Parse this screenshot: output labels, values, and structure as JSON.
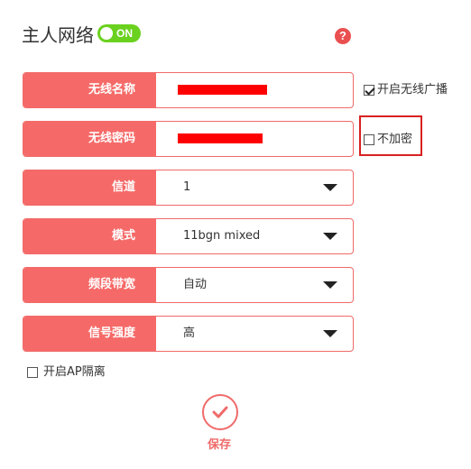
{
  "header": {
    "title": "主人网络",
    "toggle_label": "ON",
    "help_symbol": "?"
  },
  "fields": [
    {
      "label": "无线名称",
      "value": "",
      "redacted": true
    },
    {
      "label": "无线密码",
      "value": "",
      "redacted": true
    },
    {
      "label": "信道",
      "value": "1"
    },
    {
      "label": "模式",
      "value": "11bgn mixed"
    },
    {
      "label": "频段带宽",
      "value": "自动"
    },
    {
      "label": "信号强度",
      "value": "高"
    }
  ],
  "options": {
    "broadcast_label": "开启无线广播",
    "broadcast_checked": true,
    "no_encrypt_label": "不加密",
    "no_encrypt_checked": false,
    "ap_isolation_label": "开启AP隔离",
    "ap_isolation_checked": false
  },
  "save_label": "保存",
  "colors": {
    "accent": "#f56a68",
    "toggle_on": "#6bd11f",
    "highlight": "#d92020",
    "redaction": "#ff0000"
  }
}
